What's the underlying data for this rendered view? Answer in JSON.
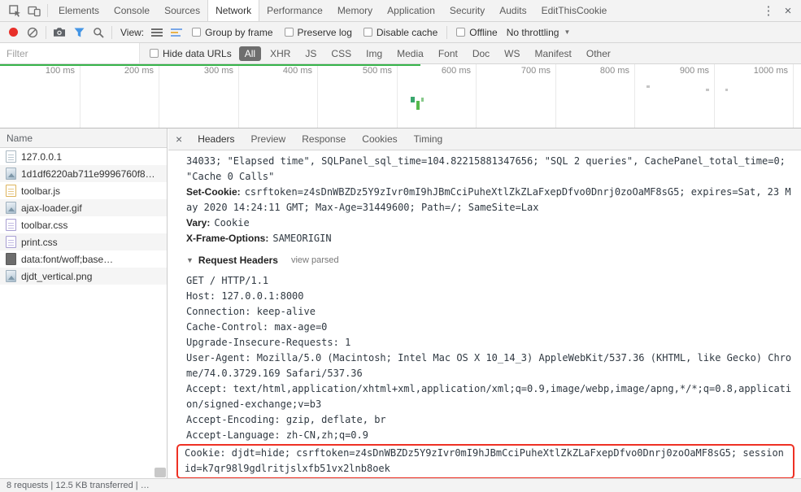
{
  "titlebar": {
    "tabs": [
      "Elements",
      "Console",
      "Sources",
      "Network",
      "Performance",
      "Memory",
      "Application",
      "Security",
      "Audits",
      "EditThisCookie"
    ],
    "active_tab": "Network",
    "kebab": "⋮",
    "close": "×"
  },
  "toolbar": {
    "view_label": "View:",
    "group_by_frame": "Group by frame",
    "preserve_log": "Preserve log",
    "disable_cache": "Disable cache",
    "offline": "Offline",
    "throttling": "No throttling",
    "throttling_caret": "▼"
  },
  "filterbar": {
    "placeholder": "Filter",
    "hide_data_urls": "Hide data URLs",
    "pills": [
      "All",
      "XHR",
      "JS",
      "CSS",
      "Img",
      "Media",
      "Font",
      "Doc",
      "WS",
      "Manifest",
      "Other"
    ],
    "active_pill": "All"
  },
  "timeline": {
    "ticks": [
      "100 ms",
      "200 ms",
      "300 ms",
      "400 ms",
      "500 ms",
      "600 ms",
      "700 ms",
      "800 ms",
      "900 ms",
      "1000 ms"
    ]
  },
  "requests": {
    "column_header": "Name",
    "items": [
      {
        "name": "127.0.0.1",
        "type": "document"
      },
      {
        "name": "1d1df6220ab711e9996760f8…",
        "type": "image"
      },
      {
        "name": "toolbar.js",
        "type": "script"
      },
      {
        "name": "ajax-loader.gif",
        "type": "image"
      },
      {
        "name": "toolbar.css",
        "type": "stylesheet"
      },
      {
        "name": "print.css",
        "type": "stylesheet"
      },
      {
        "name": "data:font/woff;base…",
        "type": "font"
      },
      {
        "name": "djdt_vertical.png",
        "type": "image"
      }
    ]
  },
  "details": {
    "close": "×",
    "tabs": [
      "Headers",
      "Preview",
      "Response",
      "Cookies",
      "Timing"
    ],
    "active_tab": "Headers",
    "scrolled_value_tail": "34033; \"Elapsed time\", SQLPanel_sql_time=104.82215881347656; \"SQL 2 queries\", CachePanel_total_time=0; \"Cache 0 Calls\"",
    "response_headers": [
      {
        "name": "Set-Cookie:",
        "value": "csrftoken=z4sDnWBZDz5Y9zIvr0mI9hJBmCciPuheXtlZkZLaFxepDfvo0Dnrj0zoOaMF8sG5; expires=Sat, 23 May 2020 14:24:11 GMT; Max-Age=31449600; Path=/; SameSite=Lax"
      },
      {
        "name": "Vary:",
        "value": "Cookie"
      },
      {
        "name": "X-Frame-Options:",
        "value": "SAMEORIGIN"
      }
    ],
    "request_headers": {
      "disclosure": "▼",
      "title": "Request Headers",
      "view_link": "view parsed",
      "lines": [
        "GET / HTTP/1.1",
        "Host: 127.0.0.1:8000",
        "Connection: keep-alive",
        "Cache-Control: max-age=0",
        "Upgrade-Insecure-Requests: 1",
        "User-Agent: Mozilla/5.0 (Macintosh; Intel Mac OS X 10_14_3) AppleWebKit/537.36 (KHTML, like Gecko) Chrome/74.0.3729.169 Safari/537.36",
        "Accept: text/html,application/xhtml+xml,application/xml;q=0.9,image/webp,image/apng,*/*;q=0.8,application/signed-exchange;v=b3",
        "Accept-Encoding: gzip, deflate, br",
        "Accept-Language: zh-CN,zh;q=0.9"
      ],
      "highlighted_line": "Cookie: djdt=hide; csrftoken=z4sDnWBZDz5Y9zIvr0mI9hJBmCciPuheXtlZkZLaFxepDfvo0Dnrj0zoOaMF8sG5; sessionid=k7qr98l9gdlritjslxfb51vx2lnb8oek"
    }
  },
  "statusbar": {
    "summary": "8 requests | 12.5 KB transferred | …"
  },
  "icons": [
    "inspect-cursor-icon",
    "device-toolbar-icon",
    "record-icon",
    "clear-icon",
    "capture-screenshots-icon",
    "filter-funnel-icon",
    "search-icon",
    "small-rows-icon",
    "overview-rows-icon",
    "kebab-menu-icon",
    "close-icon",
    "document-icon",
    "image-icon",
    "script-icon",
    "stylesheet-icon",
    "font-icon",
    "disclosure-triangle-icon",
    "dropdown-caret-icon"
  ],
  "colors": {
    "record_red": "#e8302a",
    "filter_blue": "#4596e5",
    "timeline_green": "#36b34a",
    "highlight_red": "#ee3124",
    "active_pill_bg": "#6e6e6e"
  }
}
